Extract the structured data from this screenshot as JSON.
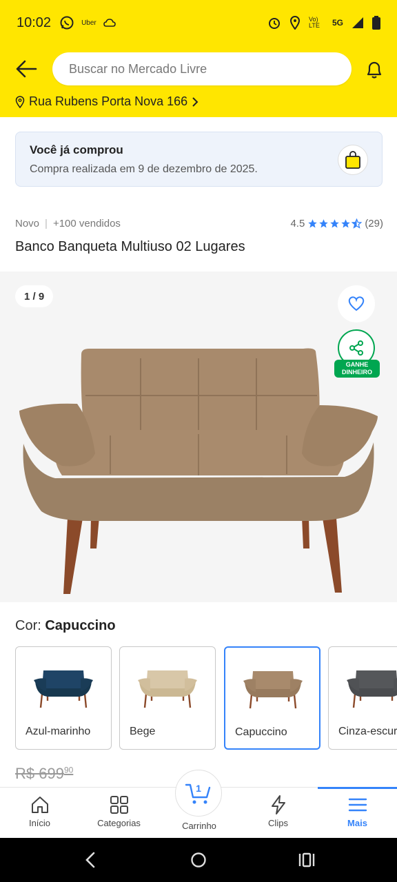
{
  "status_bar": {
    "time": "10:02",
    "uber_label": "Uber",
    "network": "5G",
    "lte_label": "Vo) LTE"
  },
  "search": {
    "placeholder": "Buscar no Mercado Livre"
  },
  "address": {
    "label": "Rua Rubens Porta Nova 166"
  },
  "purchase_notice": {
    "title": "Você já comprou",
    "subtitle": "Compra realizada em 9 de dezembro de 2025."
  },
  "product": {
    "condition": "Novo",
    "sold": "+100 vendidos",
    "rating_value": "4.5",
    "rating_stars": 4.5,
    "rating_count": "(29)",
    "title": "Banco Banqueta Multiuso 02 Lugares"
  },
  "gallery": {
    "counter": "1 / 9",
    "earn_badge": "GANHE DINHEIRO"
  },
  "color": {
    "label": "Cor:",
    "selected": "Capuccino",
    "options": [
      {
        "name": "Azul-marinho",
        "color": "#1F4466"
      },
      {
        "name": "Bege",
        "color": "#D8C7A8"
      },
      {
        "name": "Capuccino",
        "color": "#A88A6C"
      },
      {
        "name": "Cinza-escuro",
        "color": "#55575A"
      }
    ]
  },
  "price": {
    "old_main": "R$ 699",
    "old_cents": "90"
  },
  "bottom_nav": {
    "items": [
      "Início",
      "Categorias",
      "Carrinho",
      "Clips",
      "Mais"
    ],
    "cart_count": "1",
    "active": "Mais"
  },
  "colors": {
    "brand_yellow": "#FFE600",
    "accent_blue": "#3483FA",
    "green": "#00A650"
  }
}
